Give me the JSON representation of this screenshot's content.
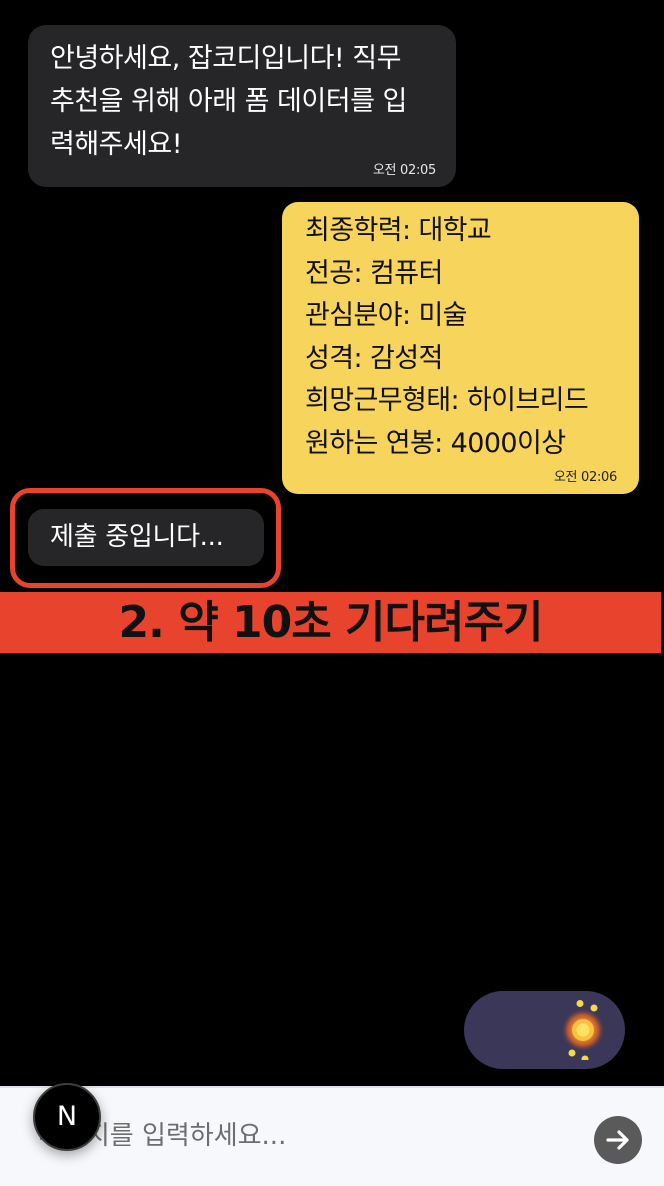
{
  "chat": {
    "bot_message": {
      "text": "안녕하세요, 잡코디입니다! 직무\n추천을 위해 아래 폼 데이터를 입\n력해주세요!",
      "time": "오전 02:05"
    },
    "user_message": {
      "lines": [
        "최종학력: 대학교",
        "전공: 컴퓨터",
        "관심분야: 미술",
        "성격: 감성적",
        "희망근무형태: 하이브리드",
        "원하는 연봉: 4000이상"
      ],
      "time": "오전 02:06"
    },
    "submitting_message": "제출 중입니다..."
  },
  "annotation": {
    "banner_text": "2. 약 10초 기다려주기",
    "color": "#e8432d"
  },
  "toggle": {
    "icon": "sun-icon",
    "track_color": "#3b3759"
  },
  "input_bar": {
    "placeholder": "메시지를 입력하세요...",
    "send_icon": "arrow-right-icon"
  },
  "badge": {
    "letter": "N"
  }
}
